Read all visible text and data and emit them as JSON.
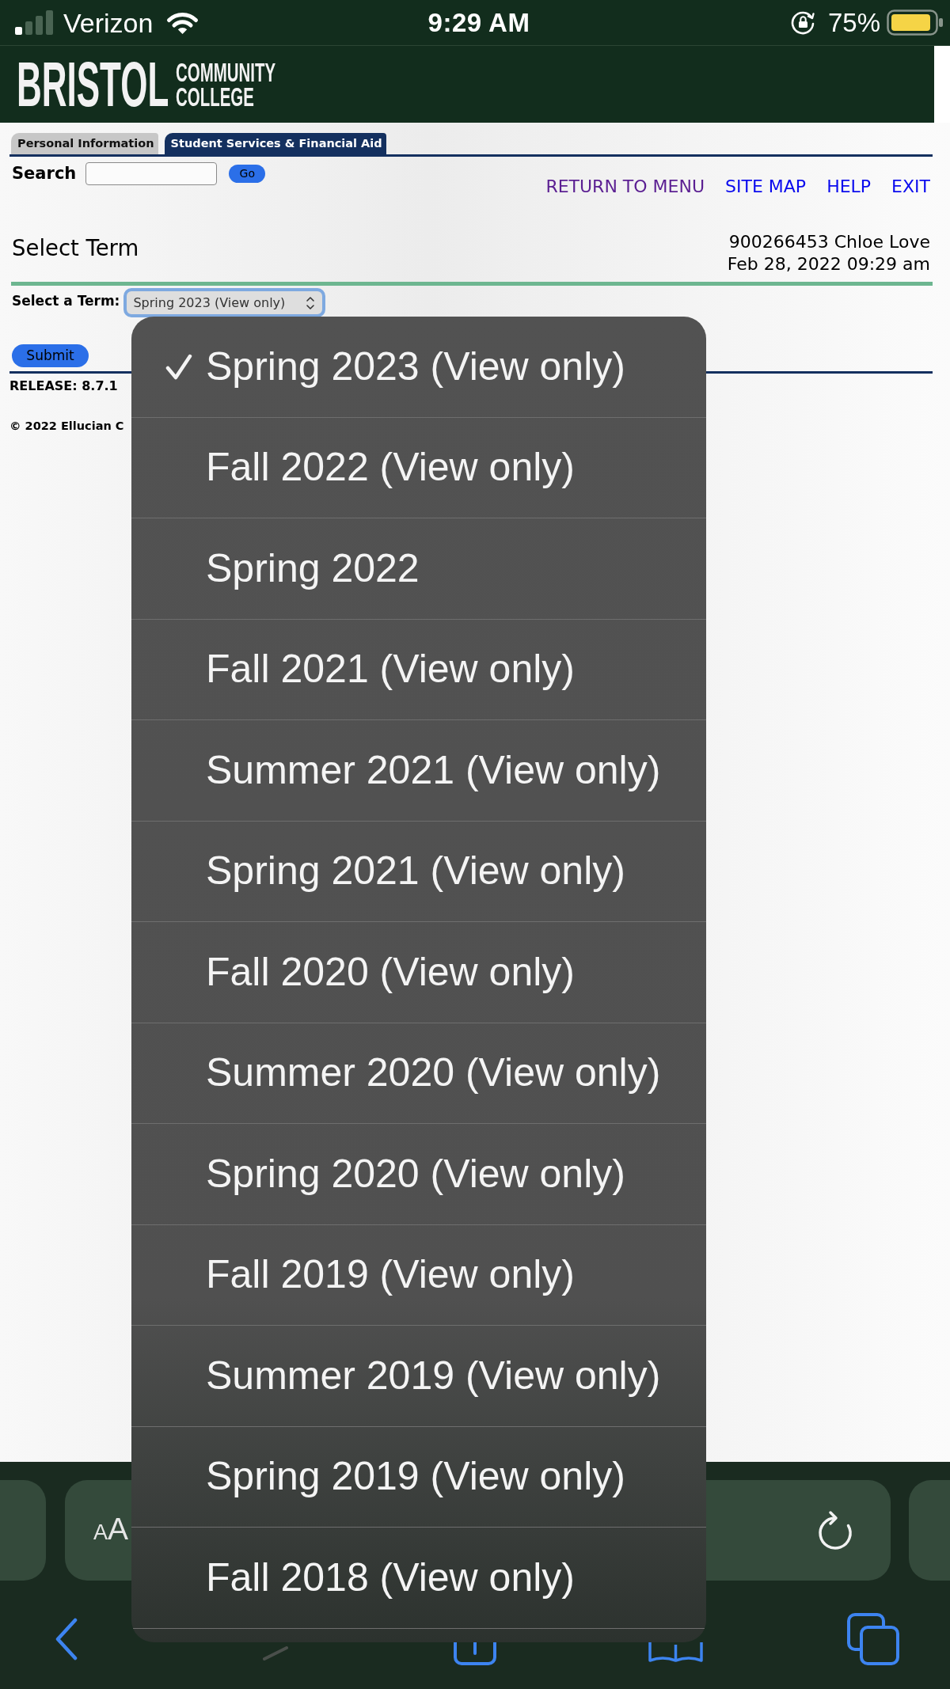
{
  "status_bar": {
    "carrier": "Verizon",
    "time": "9:29 AM",
    "battery": "75%"
  },
  "header": {
    "logo_title": "BRISTOL",
    "logo_subtitle": [
      "COMMUNITY",
      "COLLEGE"
    ]
  },
  "tabs": [
    {
      "label": "Personal Information",
      "selected": false
    },
    {
      "label": "Student Services & Financial Aid",
      "selected": true
    }
  ],
  "search": {
    "label": "Search",
    "button": "Go"
  },
  "nav_links": [
    {
      "label": "RETURN TO MENU",
      "visited": true
    },
    {
      "label": "SITE MAP",
      "visited": false
    },
    {
      "label": "HELP",
      "visited": false
    },
    {
      "label": "EXIT",
      "visited": false
    }
  ],
  "page": {
    "title": "Select Term",
    "user": "900266453 Chloe Love",
    "timestamp": "Feb 28, 2022 09:29 am"
  },
  "form": {
    "label": "Select a Term:",
    "value": "Spring 2023 (View only)",
    "submit": "Submit"
  },
  "footer": {
    "release": "RELEASE: 8.7.1",
    "copyright": "© 2022 Ellucian C"
  },
  "term_dropdown": {
    "options": [
      {
        "label": "Spring 2023 (View only)",
        "selected": true
      },
      {
        "label": "Fall 2022 (View only)",
        "selected": false
      },
      {
        "label": "Spring 2022",
        "selected": false
      },
      {
        "label": "Fall 2021 (View only)",
        "selected": false
      },
      {
        "label": "Summer 2021 (View only)",
        "selected": false
      },
      {
        "label": "Spring 2021 (View only)",
        "selected": false
      },
      {
        "label": "Fall 2020 (View only)",
        "selected": false
      },
      {
        "label": "Summer 2020 (View only)",
        "selected": false
      },
      {
        "label": "Spring 2020 (View only)",
        "selected": false
      },
      {
        "label": "Fall 2019 (View only)",
        "selected": false
      },
      {
        "label": "Summer 2019 (View only)",
        "selected": false
      },
      {
        "label": "Spring 2019 (View only)",
        "selected": false
      },
      {
        "label": "Fall 2018 (View only)",
        "selected": false
      }
    ]
  },
  "browser_toolbar": {
    "text_size_button": "AA",
    "forward_button": {
      "disabled": true
    }
  }
}
